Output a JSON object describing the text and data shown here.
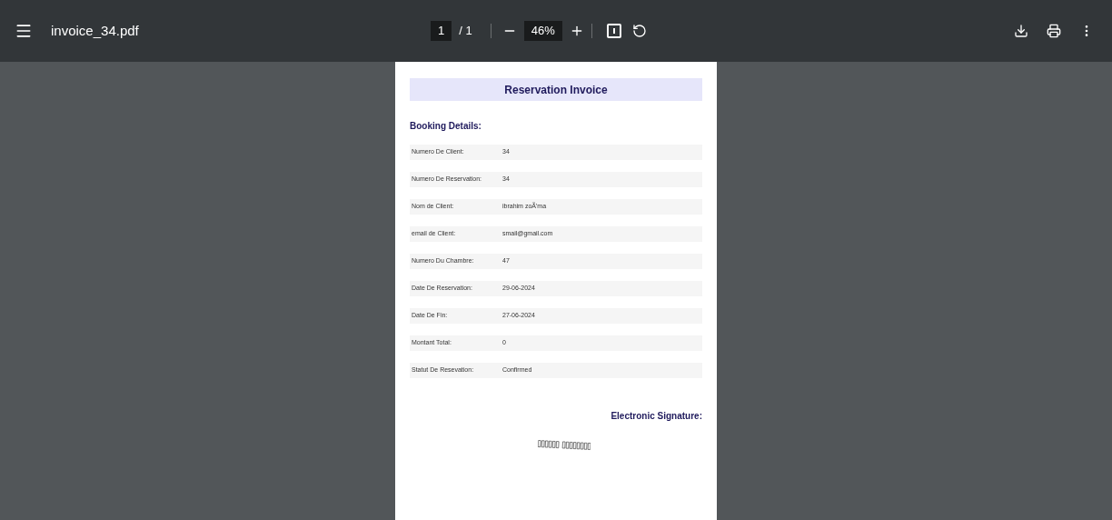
{
  "toolbar": {
    "file_name": "invoice_34.pdf",
    "page_current": "1",
    "page_total": "/ 1",
    "zoom": "46%"
  },
  "document": {
    "title": "Reservation Invoice",
    "section_heading": "Booking Details:",
    "rows": [
      {
        "label": "Numero De Client:",
        "value": "34"
      },
      {
        "label": "Numero De Reservation:",
        "value": "34"
      },
      {
        "label": "Nom de Client:",
        "value": "ibrahim zoÃ'ma"
      },
      {
        "label": "email de Client:",
        "value": "smail@gmail.com"
      },
      {
        "label": "Numero Du Chambre:",
        "value": "47"
      },
      {
        "label": "Date De Reservation:",
        "value": "29-06-2024"
      },
      {
        "label": "Date De Fin:",
        "value": "27-06-2024"
      },
      {
        "label": "Montant Total:",
        "value": "0"
      },
      {
        "label": "Statut De Resevation:",
        "value": "Confirmed"
      }
    ],
    "signature_heading": "Electronic Signature:"
  }
}
